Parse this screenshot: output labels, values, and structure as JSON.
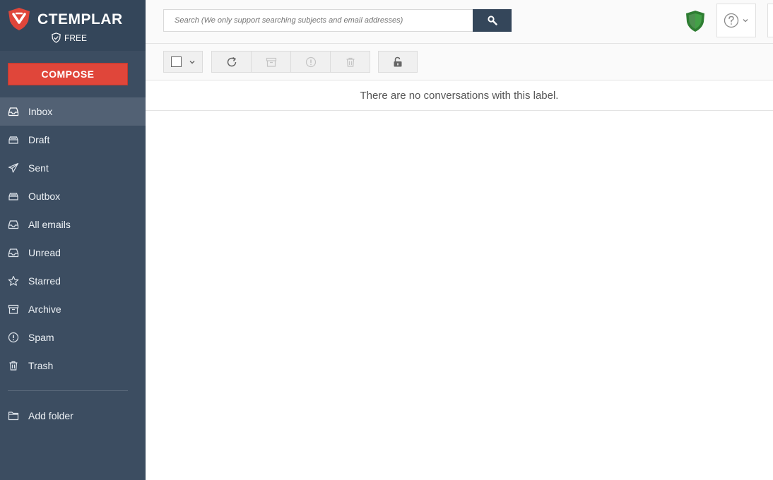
{
  "brand": {
    "name": "CTEMPLAR",
    "plan": "FREE",
    "accent": "#e0463a",
    "sidebar_bg": "#3c4d61"
  },
  "compose_label": "COMPOSE",
  "search": {
    "placeholder": "Search (We only support searching subjects and email addresses)"
  },
  "nav": {
    "items": [
      {
        "label": "Inbox",
        "icon": "inbox-icon",
        "active": true
      },
      {
        "label": "Draft",
        "icon": "draft-icon"
      },
      {
        "label": "Sent",
        "icon": "sent-icon"
      },
      {
        "label": "Outbox",
        "icon": "outbox-icon"
      },
      {
        "label": "All emails",
        "icon": "all-emails-icon"
      },
      {
        "label": "Unread",
        "icon": "unread-icon"
      },
      {
        "label": "Starred",
        "icon": "star-icon"
      },
      {
        "label": "Archive",
        "icon": "archive-icon"
      },
      {
        "label": "Spam",
        "icon": "spam-icon"
      },
      {
        "label": "Trash",
        "icon": "trash-icon"
      }
    ],
    "add_folder": "Add folder"
  },
  "toolbar": {
    "icons": [
      "checkbox-icon",
      "refresh-icon",
      "archive-icon",
      "spam-icon",
      "trash-icon",
      "unlock-icon"
    ]
  },
  "status": {
    "security_color": "#2e7d32"
  },
  "main": {
    "empty_message": "There are no conversations with this label."
  }
}
